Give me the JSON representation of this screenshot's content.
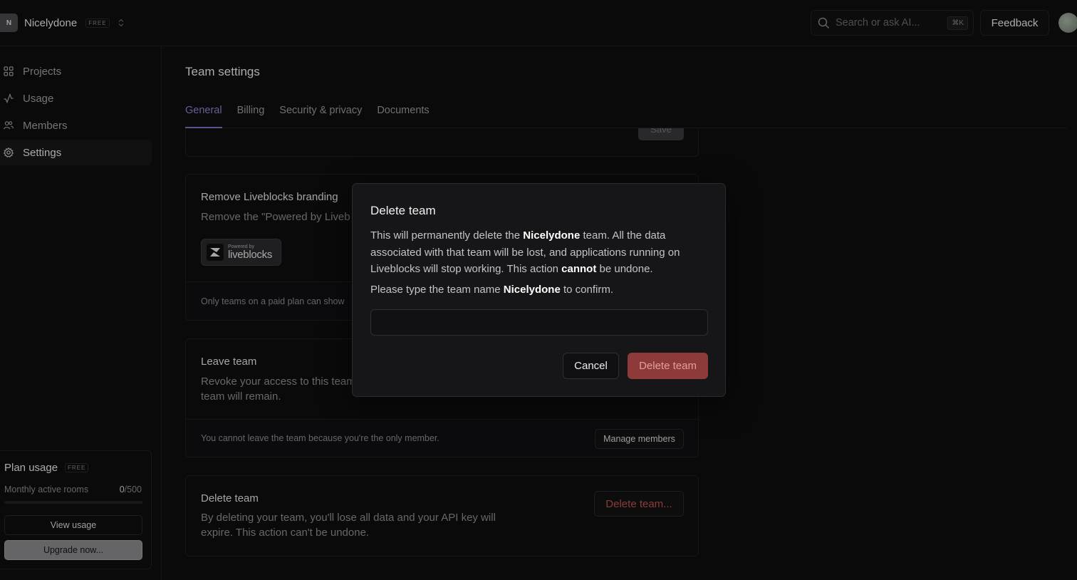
{
  "header": {
    "team_initial": "N",
    "team_name": "Nicelydone",
    "plan_badge": "FREE",
    "search_placeholder": "Search or ask AI...",
    "search_shortcut": "⌘K",
    "feedback_label": "Feedback"
  },
  "sidebar": {
    "items": [
      {
        "label": "Projects",
        "icon": "grid-icon"
      },
      {
        "label": "Usage",
        "icon": "activity-icon"
      },
      {
        "label": "Members",
        "icon": "users-icon"
      },
      {
        "label": "Settings",
        "icon": "gear-icon",
        "active": true
      }
    ],
    "plan": {
      "title": "Plan usage",
      "badge": "FREE",
      "metric_label": "Monthly active rooms",
      "metric_used": "0",
      "metric_limit": "/500",
      "usage_fraction": 0,
      "view_usage_label": "View usage",
      "upgrade_label": "Upgrade now..."
    }
  },
  "main": {
    "title": "Team settings",
    "tabs": [
      {
        "label": "General",
        "active": true
      },
      {
        "label": "Billing"
      },
      {
        "label": "Security & privacy"
      },
      {
        "label": "Documents"
      }
    ],
    "save_label": "Save",
    "branding": {
      "title": "Remove Liveblocks branding",
      "desc": "Remove the \"Powered by Liveb",
      "badge_small": "Powered by",
      "badge_big": "liveblocks",
      "foot": "Only teams on a paid plan can show"
    },
    "leave": {
      "title": "Leave team",
      "desc_line1": "Revoke your access to this team",
      "desc_line2": "team will remain.",
      "foot": "You cannot leave the team because you're the only member.",
      "button": "Manage members"
    },
    "delete": {
      "title": "Delete team",
      "desc_line1": "By deleting your team, you'll lose all data and your API key will",
      "desc_line2": "expire. This action can't be undone.",
      "button": "Delete team..."
    }
  },
  "modal": {
    "title": "Delete team",
    "body_1": "This will permanently delete the ",
    "team_name": "Nicelydone",
    "body_2": " team. All the data associated with that team will be lost, and applications running on Liveblocks will stop working. This action ",
    "body_strong": "cannot",
    "body_3": " be undone.",
    "confirm_1": "Please type the team name ",
    "confirm_team": "Nicelydone",
    "confirm_2": " to confirm.",
    "input_value": "",
    "cancel_label": "Cancel",
    "delete_label": "Delete team"
  },
  "colors": {
    "accent": "#7e71c7",
    "danger": "#8e3a3a",
    "danger_text": "#c0524f"
  }
}
